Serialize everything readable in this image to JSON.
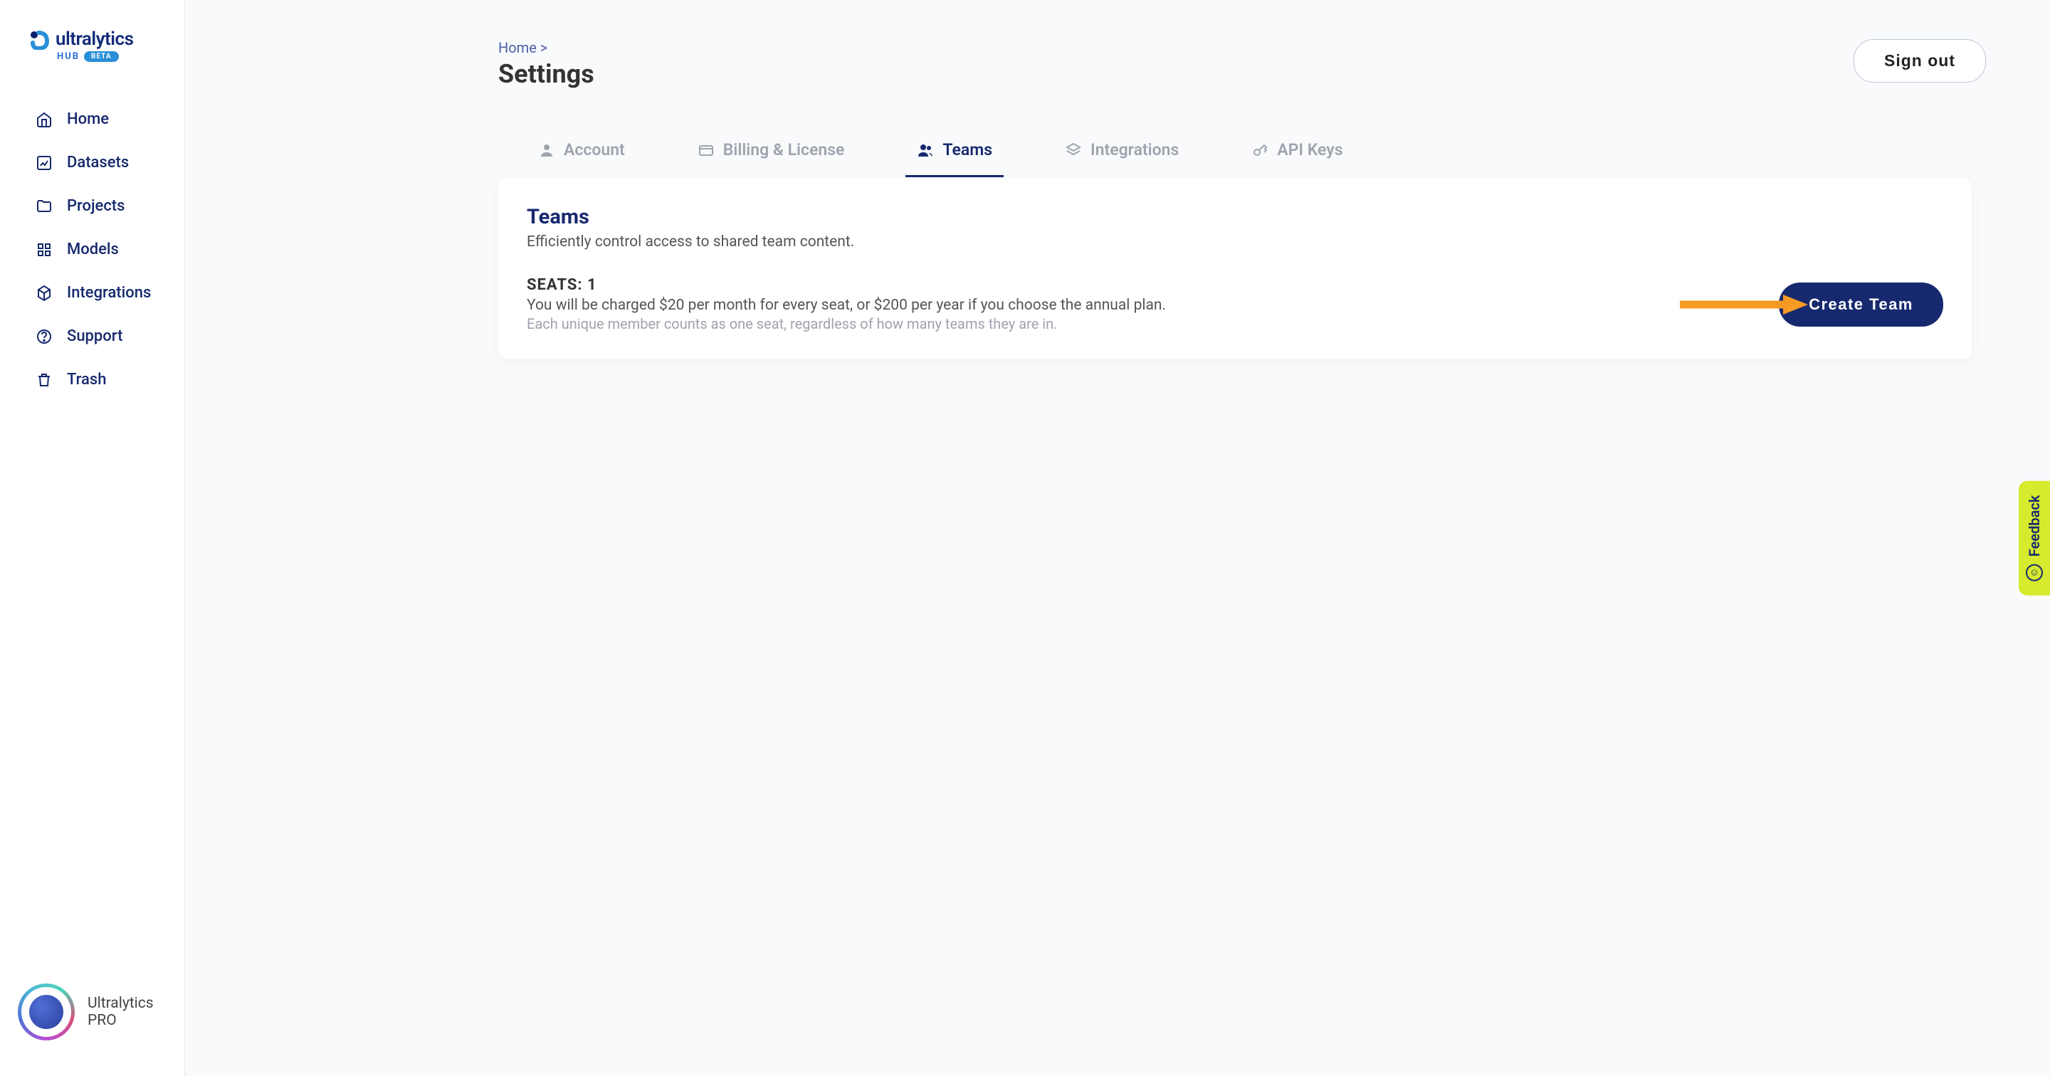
{
  "brand": {
    "name": "ultralytics",
    "sub": "HUB",
    "badge": "BETA"
  },
  "sidebar": {
    "items": [
      {
        "label": "Home",
        "icon": "home-icon"
      },
      {
        "label": "Datasets",
        "icon": "datasets-icon"
      },
      {
        "label": "Projects",
        "icon": "projects-icon"
      },
      {
        "label": "Models",
        "icon": "models-icon"
      },
      {
        "label": "Integrations",
        "icon": "integrations-icon"
      },
      {
        "label": "Support",
        "icon": "support-icon"
      },
      {
        "label": "Trash",
        "icon": "trash-icon"
      }
    ]
  },
  "user": {
    "name": "Ultralytics",
    "plan": "PRO"
  },
  "breadcrumb": {
    "home": "Home",
    "sep": ">"
  },
  "page": {
    "title": "Settings"
  },
  "header": {
    "signout": "Sign out"
  },
  "tabs": [
    {
      "label": "Account",
      "active": false
    },
    {
      "label": "Billing & License",
      "active": false
    },
    {
      "label": "Teams",
      "active": true
    },
    {
      "label": "Integrations",
      "active": false
    },
    {
      "label": "API Keys",
      "active": false
    }
  ],
  "teams": {
    "title": "Teams",
    "subtitle": "Efficiently control access to shared team content.",
    "seats_label": "SEATS: 1",
    "seats_desc": "You will be charged $20 per month for every seat, or $200 per year if you choose the annual plan.",
    "seats_note": "Each unique member counts as one seat, regardless of how many teams they are in.",
    "create_btn": "Create Team"
  },
  "feedback": {
    "label": "Feedback"
  }
}
